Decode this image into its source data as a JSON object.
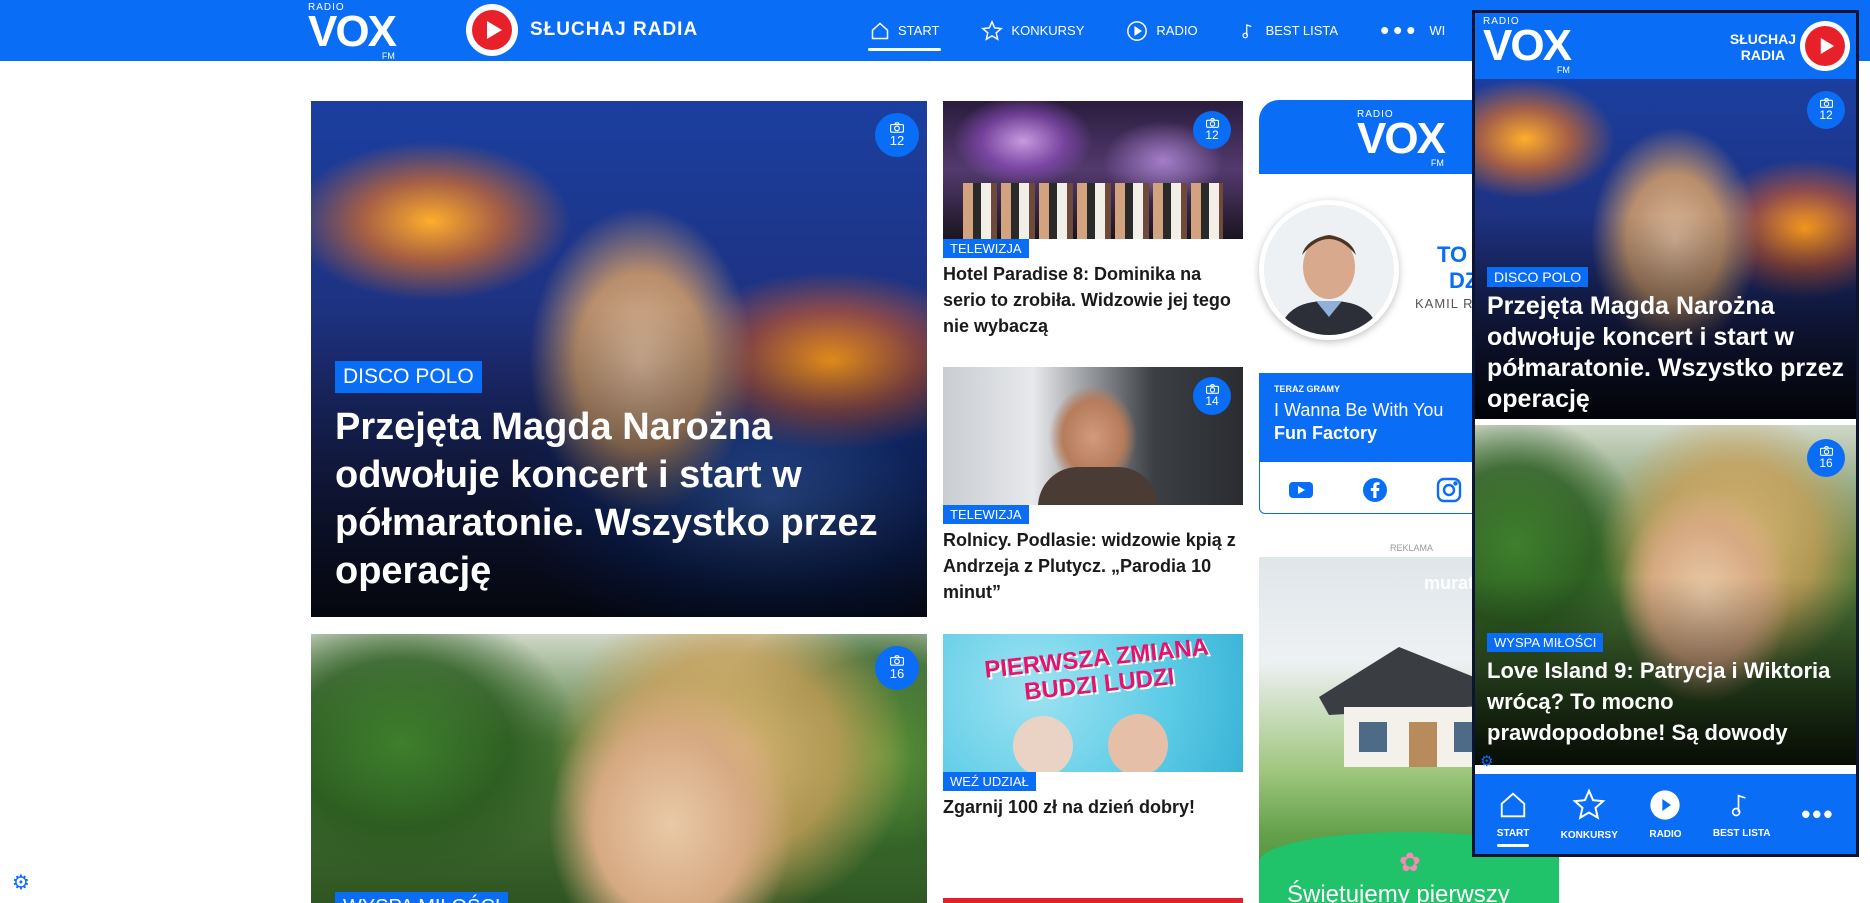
{
  "header": {
    "logo": {
      "top": "RADIO",
      "main": "VOX",
      "suffix": "FM"
    },
    "listen_label": "SŁUCHAJ RADIA",
    "nav": [
      {
        "label": "START",
        "icon": "home-icon",
        "active": true
      },
      {
        "label": "KONKURSY",
        "icon": "star-icon",
        "active": false
      },
      {
        "label": "RADIO",
        "icon": "play-icon",
        "active": false
      },
      {
        "label": "BEST LISTA",
        "icon": "music-note-icon",
        "active": false
      }
    ],
    "more_label": "WI",
    "brand_color": "#0a6df5"
  },
  "main_articles": [
    {
      "category": "DISCO POLO",
      "title": "Przejęta Magda Narożna odwołuje koncert i start w półmaratonie. Wszystko przez operację",
      "photos": "12"
    },
    {
      "category": "WYSPA MIŁOŚCI",
      "photos": "16"
    }
  ],
  "side_articles": [
    {
      "category": "TELEWIZJA",
      "title": "Hotel Paradise 8: Dominika na serio to zrobiła. Widzowie jej tego nie wybaczą",
      "photos": "12"
    },
    {
      "category": "TELEWIZJA",
      "title": "Rolnicy. Podlasie: widzowie kpią z Andrzeja z Plutycz. „Parodia 10 minut”",
      "photos": "14"
    },
    {
      "category": "WEŹ UDZIAŁ",
      "title": "Zgarnij 100 zł na dzień dobry!",
      "banner_text": "PIERWSZA ZMIANA BUDZI LUDZI"
    }
  ],
  "widget": {
    "logo": {
      "top": "RADIO",
      "main": "VOX",
      "suffix": "FM"
    },
    "host_title_line1": "TO",
    "host_title_line2": "DZ",
    "host_name": "KAMIL R",
    "now_playing_label": "TERAZ GRAMY",
    "song": "I Wanna Be With You",
    "artist": "Fun Factory",
    "socials": [
      "youtube-icon",
      "facebook-icon",
      "instagram-icon"
    ]
  },
  "ad": {
    "label": "REKLAMA",
    "brand": "murato",
    "slogan": "Świętujemy pierwszy"
  },
  "mobile": {
    "logo": {
      "top": "RADIO",
      "main": "VOX",
      "suffix": "FM"
    },
    "listen_line1": "SŁUCHAJ",
    "listen_line2": "RADIA",
    "articles": [
      {
        "category": "DISCO POLO",
        "title": "Przejęta Magda Narożna odwołuje koncert i start w półmaratonie. Wszystko przez operację",
        "photos": "12"
      },
      {
        "category": "WYSPA MIŁOŚCI",
        "title": "Love Island 9: Patrycja i Wiktoria wrócą? To mocno prawdopodobne! Są dowody",
        "photos": "16"
      }
    ],
    "nav": [
      {
        "label": "START",
        "icon": "home-icon",
        "active": true
      },
      {
        "label": "KONKURSY",
        "icon": "star-icon",
        "active": false
      },
      {
        "label": "RADIO",
        "icon": "play-icon",
        "active": false
      },
      {
        "label": "BEST LISTA",
        "icon": "music-note-icon",
        "active": false
      }
    ]
  }
}
